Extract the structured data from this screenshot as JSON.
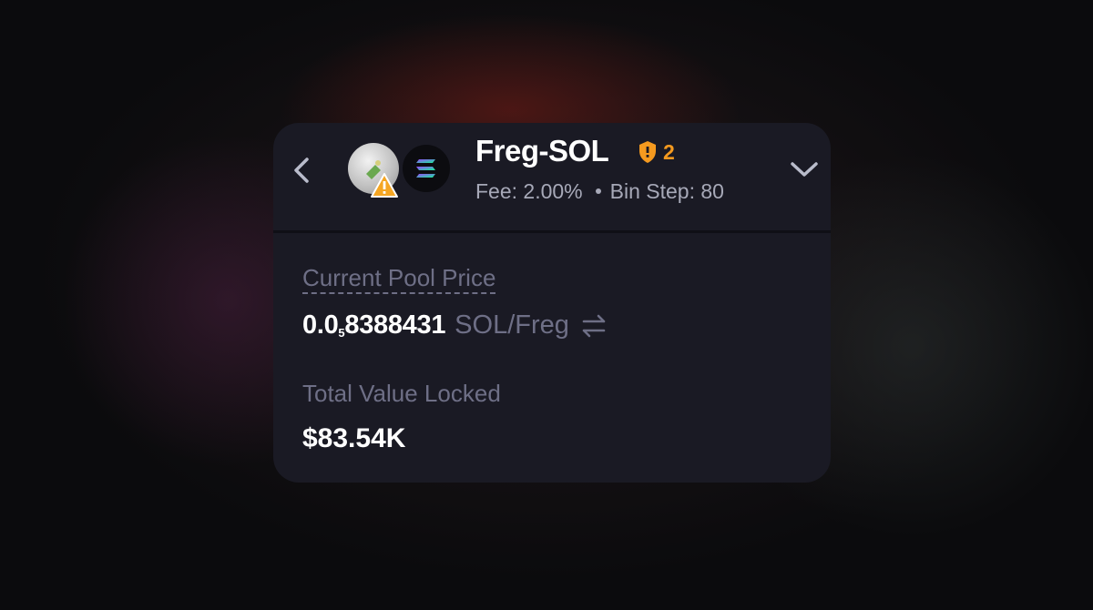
{
  "pool": {
    "pair_name": "Freg-SOL",
    "shield_count": "2",
    "fee_text": "Fee: 2.00%",
    "bin_step_text": "Bin Step: 80"
  },
  "icons": {
    "back": "chevron-left-icon",
    "token_a": "freg-token-icon",
    "token_b": "sol-token-icon",
    "warning": "warning-triangle-icon",
    "shield": "shield-icon",
    "expand": "chevron-down-icon",
    "swap": "swap-arrows-icon"
  },
  "price": {
    "label": "Current Pool Price",
    "prefix": "0.0",
    "zero_count": "5",
    "digits": "8388431",
    "unit": "SOL/Freg"
  },
  "tvl": {
    "label": "Total Value Locked",
    "value": "$83.54K"
  },
  "colors": {
    "card_bg": "#1a1a24",
    "accent_orange": "#f59a1f",
    "muted_text": "#6e6f86"
  }
}
